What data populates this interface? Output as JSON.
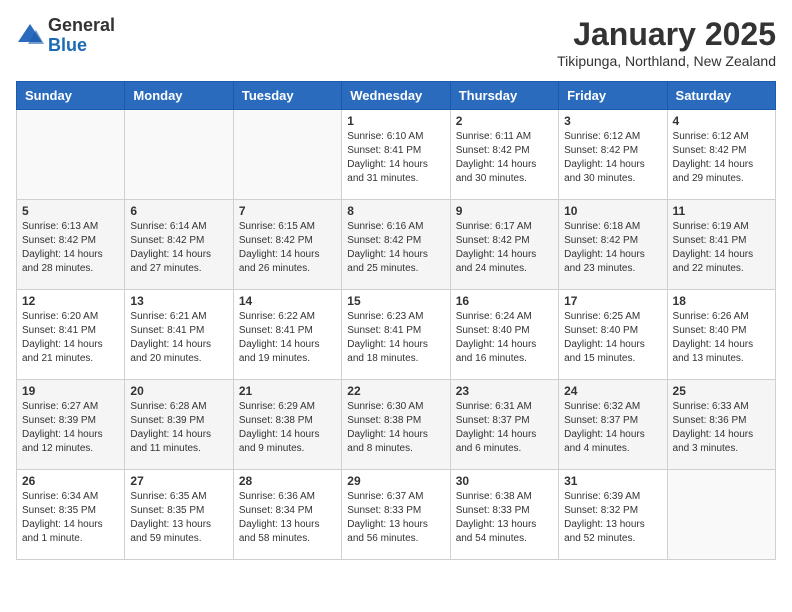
{
  "header": {
    "logo": {
      "line1": "General",
      "line2": "Blue"
    },
    "title": "January 2025",
    "location": "Tikipunga, Northland, New Zealand"
  },
  "weekdays": [
    "Sunday",
    "Monday",
    "Tuesday",
    "Wednesday",
    "Thursday",
    "Friday",
    "Saturday"
  ],
  "weeks": [
    [
      {
        "day": "",
        "info": ""
      },
      {
        "day": "",
        "info": ""
      },
      {
        "day": "",
        "info": ""
      },
      {
        "day": "1",
        "info": "Sunrise: 6:10 AM\nSunset: 8:41 PM\nDaylight: 14 hours\nand 31 minutes."
      },
      {
        "day": "2",
        "info": "Sunrise: 6:11 AM\nSunset: 8:42 PM\nDaylight: 14 hours\nand 30 minutes."
      },
      {
        "day": "3",
        "info": "Sunrise: 6:12 AM\nSunset: 8:42 PM\nDaylight: 14 hours\nand 30 minutes."
      },
      {
        "day": "4",
        "info": "Sunrise: 6:12 AM\nSunset: 8:42 PM\nDaylight: 14 hours\nand 29 minutes."
      }
    ],
    [
      {
        "day": "5",
        "info": "Sunrise: 6:13 AM\nSunset: 8:42 PM\nDaylight: 14 hours\nand 28 minutes."
      },
      {
        "day": "6",
        "info": "Sunrise: 6:14 AM\nSunset: 8:42 PM\nDaylight: 14 hours\nand 27 minutes."
      },
      {
        "day": "7",
        "info": "Sunrise: 6:15 AM\nSunset: 8:42 PM\nDaylight: 14 hours\nand 26 minutes."
      },
      {
        "day": "8",
        "info": "Sunrise: 6:16 AM\nSunset: 8:42 PM\nDaylight: 14 hours\nand 25 minutes."
      },
      {
        "day": "9",
        "info": "Sunrise: 6:17 AM\nSunset: 8:42 PM\nDaylight: 14 hours\nand 24 minutes."
      },
      {
        "day": "10",
        "info": "Sunrise: 6:18 AM\nSunset: 8:42 PM\nDaylight: 14 hours\nand 23 minutes."
      },
      {
        "day": "11",
        "info": "Sunrise: 6:19 AM\nSunset: 8:41 PM\nDaylight: 14 hours\nand 22 minutes."
      }
    ],
    [
      {
        "day": "12",
        "info": "Sunrise: 6:20 AM\nSunset: 8:41 PM\nDaylight: 14 hours\nand 21 minutes."
      },
      {
        "day": "13",
        "info": "Sunrise: 6:21 AM\nSunset: 8:41 PM\nDaylight: 14 hours\nand 20 minutes."
      },
      {
        "day": "14",
        "info": "Sunrise: 6:22 AM\nSunset: 8:41 PM\nDaylight: 14 hours\nand 19 minutes."
      },
      {
        "day": "15",
        "info": "Sunrise: 6:23 AM\nSunset: 8:41 PM\nDaylight: 14 hours\nand 18 minutes."
      },
      {
        "day": "16",
        "info": "Sunrise: 6:24 AM\nSunset: 8:40 PM\nDaylight: 14 hours\nand 16 minutes."
      },
      {
        "day": "17",
        "info": "Sunrise: 6:25 AM\nSunset: 8:40 PM\nDaylight: 14 hours\nand 15 minutes."
      },
      {
        "day": "18",
        "info": "Sunrise: 6:26 AM\nSunset: 8:40 PM\nDaylight: 14 hours\nand 13 minutes."
      }
    ],
    [
      {
        "day": "19",
        "info": "Sunrise: 6:27 AM\nSunset: 8:39 PM\nDaylight: 14 hours\nand 12 minutes."
      },
      {
        "day": "20",
        "info": "Sunrise: 6:28 AM\nSunset: 8:39 PM\nDaylight: 14 hours\nand 11 minutes."
      },
      {
        "day": "21",
        "info": "Sunrise: 6:29 AM\nSunset: 8:38 PM\nDaylight: 14 hours\nand 9 minutes."
      },
      {
        "day": "22",
        "info": "Sunrise: 6:30 AM\nSunset: 8:38 PM\nDaylight: 14 hours\nand 8 minutes."
      },
      {
        "day": "23",
        "info": "Sunrise: 6:31 AM\nSunset: 8:37 PM\nDaylight: 14 hours\nand 6 minutes."
      },
      {
        "day": "24",
        "info": "Sunrise: 6:32 AM\nSunset: 8:37 PM\nDaylight: 14 hours\nand 4 minutes."
      },
      {
        "day": "25",
        "info": "Sunrise: 6:33 AM\nSunset: 8:36 PM\nDaylight: 14 hours\nand 3 minutes."
      }
    ],
    [
      {
        "day": "26",
        "info": "Sunrise: 6:34 AM\nSunset: 8:35 PM\nDaylight: 14 hours\nand 1 minute."
      },
      {
        "day": "27",
        "info": "Sunrise: 6:35 AM\nSunset: 8:35 PM\nDaylight: 13 hours\nand 59 minutes."
      },
      {
        "day": "28",
        "info": "Sunrise: 6:36 AM\nSunset: 8:34 PM\nDaylight: 13 hours\nand 58 minutes."
      },
      {
        "day": "29",
        "info": "Sunrise: 6:37 AM\nSunset: 8:33 PM\nDaylight: 13 hours\nand 56 minutes."
      },
      {
        "day": "30",
        "info": "Sunrise: 6:38 AM\nSunset: 8:33 PM\nDaylight: 13 hours\nand 54 minutes."
      },
      {
        "day": "31",
        "info": "Sunrise: 6:39 AM\nSunset: 8:32 PM\nDaylight: 13 hours\nand 52 minutes."
      },
      {
        "day": "",
        "info": ""
      }
    ]
  ]
}
